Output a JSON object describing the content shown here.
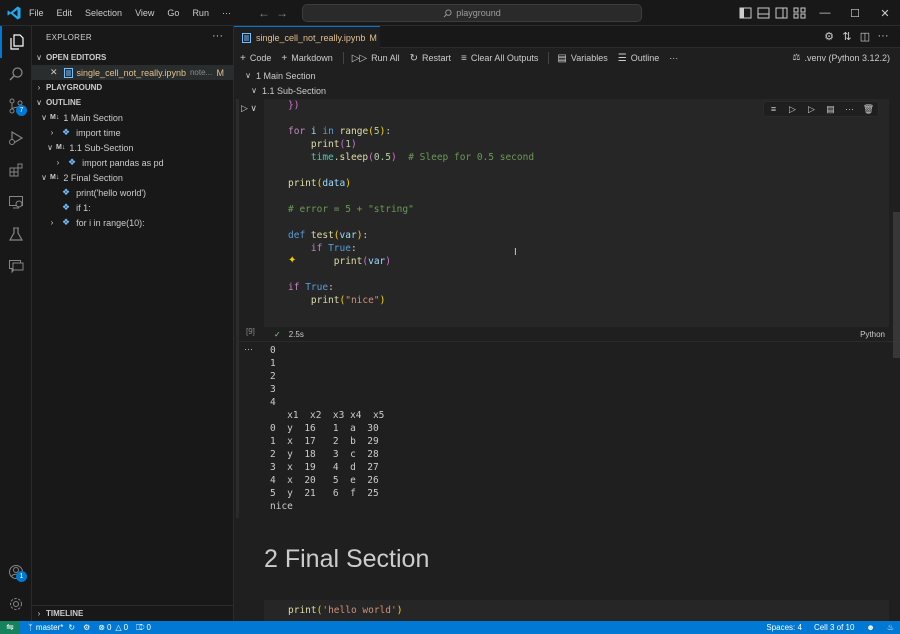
{
  "window": {
    "menu": [
      "File",
      "Edit",
      "Selection",
      "View",
      "Go",
      "Run",
      "···"
    ],
    "search_placeholder": "playground"
  },
  "activity_bar": {
    "source_control_badge": "7",
    "accounts_badge": "1"
  },
  "sidebar": {
    "title": "EXPLORER",
    "more": "···",
    "open_editors_label": "OPEN EDITORS",
    "open_editor": {
      "name": "single_cell_not_really.ipynb",
      "path": "note...",
      "status": "M"
    },
    "playground_label": "PLAYGROUND",
    "outline_label": "OUTLINE",
    "outline_items": [
      {
        "label": "1 Main Section",
        "type": "md"
      },
      {
        "label": "import time",
        "type": "code"
      },
      {
        "label": "1.1 Sub-Section",
        "type": "md"
      },
      {
        "label": "import pandas as pd",
        "type": "code"
      },
      {
        "label": "2 Final Section",
        "type": "md"
      },
      {
        "label": "print('hello world')",
        "type": "code"
      },
      {
        "label": "if 1:",
        "type": "code"
      },
      {
        "label": "for i in range(10):",
        "type": "code"
      }
    ],
    "timeline_label": "TIMELINE"
  },
  "editor": {
    "tab": {
      "name": "single_cell_not_really.ipynb",
      "status": "M"
    },
    "toolbar": {
      "code": "Code",
      "markdown": "Markdown",
      "run_all": "Run All",
      "restart": "Restart",
      "clear_outputs": "Clear All Outputs",
      "variables": "Variables",
      "outline": "Outline",
      "more": "···",
      "kernel": ".venv (Python 3.12.2)"
    },
    "sticky": [
      "1 Main Section",
      "1.1 Sub-Section"
    ],
    "cell": {
      "exec_count": "[9]",
      "duration": "2.5s",
      "language": "Python"
    },
    "output_dots": "···",
    "output": [
      "0",
      "1",
      "2",
      "3",
      "4",
      "   x1  x2  x3 x4  x5",
      "0  y  16   1  a  30",
      "1  x  17   2  b  29",
      "2  y  18   3  c  28",
      "3  x  19   4  d  27",
      "4  x  20   5  e  26",
      "5  y  21   6  f  25",
      "nice"
    ],
    "md_heading": "2 Final Section"
  },
  "statusbar": {
    "branch": "master*",
    "errors": "0",
    "warnings": "0",
    "ports": "0",
    "spaces": "Spaces: 4",
    "cell": "Cell 3 of 10"
  }
}
